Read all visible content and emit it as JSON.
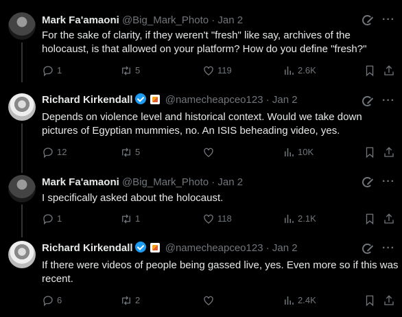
{
  "tweets": [
    {
      "name": "Mark Fa'amaoni",
      "handle": "@Big_Mark_Photo",
      "sep": "·",
      "date": "Jan 2",
      "text": "For the sake of clarity, if they weren't \"fresh\" like say, archives of the holocaust, is that allowed on your platform? How do you define \"fresh?\"",
      "replies": "1",
      "reposts": "5",
      "likes": "119",
      "views": "2.6K"
    },
    {
      "name": "Richard Kirkendall",
      "handle": "@namecheapceo123",
      "sep": "·",
      "date": "Jan 2",
      "text": "Depends on violence level and historical context. Would we take down pictures of Egyptian mummies, no. An ISIS beheading video, yes.",
      "replies": "12",
      "reposts": "5",
      "likes": "",
      "views": "10K"
    },
    {
      "name": "Mark Fa'amaoni",
      "handle": "@Big_Mark_Photo",
      "sep": "·",
      "date": "Jan 2",
      "text": "I specifically asked about the holocaust.",
      "replies": "1",
      "reposts": "1",
      "likes": "118",
      "views": "2.1K"
    },
    {
      "name": "Richard Kirkendall",
      "handle": "@namecheapceo123",
      "sep": "·",
      "date": "Jan 2",
      "text": "If there were videos of people being gassed live, yes. Even more so if this was recent.",
      "replies": "6",
      "reposts": "2",
      "likes": "",
      "views": "2.4K"
    }
  ],
  "more_label": "···",
  "icons": {
    "reply": "reply-icon",
    "repost": "repost-icon",
    "like": "heart-icon",
    "views": "views-icon",
    "bookmark": "bookmark-icon",
    "share": "share-icon",
    "grok": "grok-icon",
    "verified": "verified-badge-icon",
    "affiliate": "affiliate-badge-icon"
  },
  "colors": {
    "background": "#000000",
    "text": "#e7e9ea",
    "muted": "#71767b",
    "verified": "#1d9bf0"
  }
}
